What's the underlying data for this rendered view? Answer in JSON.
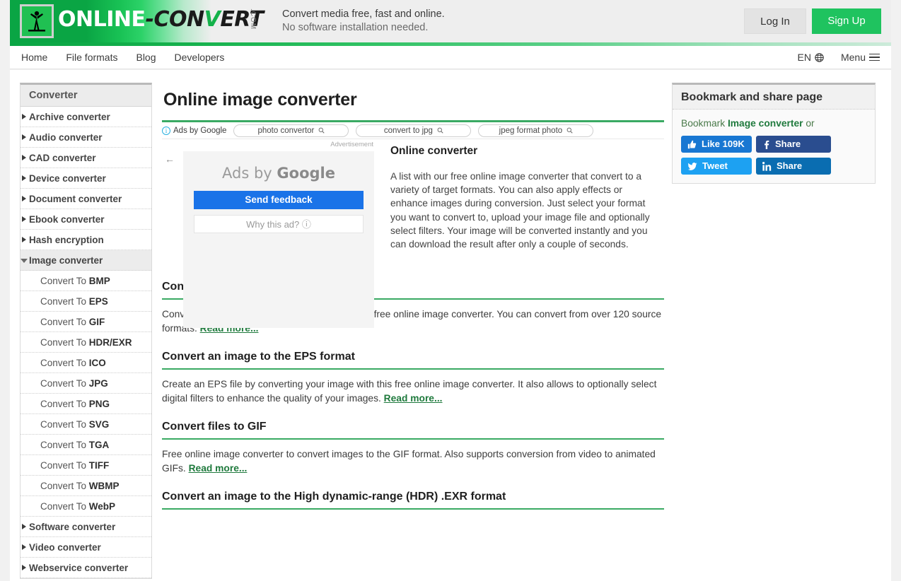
{
  "header": {
    "logo": {
      "icon": "person-figure-icon",
      "part1": "ONLINE",
      "dash": "-",
      "part2a": "CON",
      "part2b": "V",
      "part2c": "ERT",
      "com": ".COM"
    },
    "tagline_line1": "Convert media free, fast and online.",
    "tagline_line2": "No software installation needed.",
    "login_label": "Log In",
    "signup_label": "Sign Up",
    "signup_color": "#1fc35f"
  },
  "nav": {
    "items": [
      {
        "label": "Home"
      },
      {
        "label": "File formats"
      },
      {
        "label": "Blog"
      },
      {
        "label": "Developers"
      }
    ],
    "language": "EN",
    "menu_label": "Menu"
  },
  "sidebar": {
    "title": "Converter",
    "groups": [
      {
        "label": "Archive converter",
        "expanded": false
      },
      {
        "label": "Audio converter",
        "expanded": false
      },
      {
        "label": "CAD converter",
        "expanded": false
      },
      {
        "label": "Device converter",
        "expanded": false
      },
      {
        "label": "Document converter",
        "expanded": false
      },
      {
        "label": "Ebook converter",
        "expanded": false
      },
      {
        "label": "Hash encryption",
        "expanded": false
      },
      {
        "label": "Image converter",
        "expanded": true
      }
    ],
    "image_items": [
      {
        "prefix": "Convert To ",
        "format": "BMP"
      },
      {
        "prefix": "Convert To ",
        "format": "EPS"
      },
      {
        "prefix": "Convert To ",
        "format": "GIF"
      },
      {
        "prefix": "Convert To ",
        "format": "HDR/EXR"
      },
      {
        "prefix": "Convert To ",
        "format": "ICO"
      },
      {
        "prefix": "Convert To ",
        "format": "JPG"
      },
      {
        "prefix": "Convert To ",
        "format": "PNG"
      },
      {
        "prefix": "Convert To ",
        "format": "SVG"
      },
      {
        "prefix": "Convert To ",
        "format": "TGA"
      },
      {
        "prefix": "Convert To ",
        "format": "TIFF"
      },
      {
        "prefix": "Convert To ",
        "format": "WBMP"
      },
      {
        "prefix": "Convert To ",
        "format": "WebP"
      }
    ],
    "groups_after": [
      {
        "label": "Software converter",
        "expanded": false
      },
      {
        "label": "Video converter",
        "expanded": false
      },
      {
        "label": "Webservice converter",
        "expanded": false
      }
    ]
  },
  "main": {
    "page_title": "Online image converter",
    "ads_by_google_label": "Ads by Google",
    "ad_chips": [
      {
        "label": "photo convertor"
      },
      {
        "label": "convert to jpg"
      },
      {
        "label": "jpeg format photo"
      }
    ],
    "ad_block": {
      "advertisement_label": "Advertisement",
      "ads_by": "Ads by ",
      "ads_brand": "Google",
      "send_feedback_label": "Send feedback",
      "why_this_ad_label": "Why this ad? ⓘ"
    },
    "intro": {
      "heading": "Online converter",
      "text": "A list with our free online image converter that convert to a variety of target formats. You can also apply effects or enhance images during conversion. Just select your format you want to convert to, upload your image file and optionally select filters. Your image will be converted instantly and you can download the result after only a couple of seconds."
    },
    "sections": [
      {
        "heading": "Convert an image to the BMP format",
        "body": "Convert your images to the BMP format with this free online image converter. You can convert from over 120 source formats. ",
        "link": "Read more..."
      },
      {
        "heading": "Convert an image to the EPS format",
        "body": "Create an EPS file by converting your image with this free online image converter. It also allows to optionally select digital filters to enhance the quality of your images. ",
        "link": "Read more..."
      },
      {
        "heading": "Convert files to GIF",
        "body": "Free online image converter to convert images to the GIF format. Also supports conversion from video to animated GIFs. ",
        "link": "Read more..."
      },
      {
        "heading": "Convert an image to the High dynamic-range (HDR) .EXR format",
        "body": "",
        "link": ""
      }
    ]
  },
  "right_column": {
    "title": "Bookmark and share page",
    "bookmark_prefix": "Bookmark ",
    "bookmark_link": "Image converter",
    "bookmark_suffix": " or",
    "share_buttons": [
      {
        "name": "facebook-like",
        "label": "Like 109K",
        "color": "#1877d2"
      },
      {
        "name": "facebook-share",
        "label": "Share",
        "color": "#2a4d8f"
      },
      {
        "name": "twitter-tweet",
        "label": "Tweet",
        "color": "#1da1f2"
      },
      {
        "name": "linkedin-share",
        "label": "Share",
        "color": "#0a6db1"
      }
    ]
  }
}
